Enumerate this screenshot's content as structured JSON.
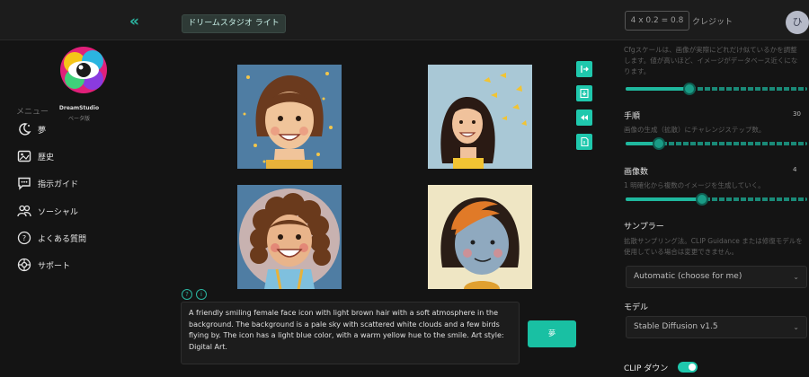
{
  "topbar": {
    "studio_button": "ドリームスタジオ ライト",
    "credit_formula": "4 x 0.2 = 0.8",
    "credit_label": "クレジット",
    "avatar_initial": "ひ"
  },
  "sidebar": {
    "app_name": "DreamStudio",
    "app_subtitle": "ベータ版",
    "menu_label": "メニュー",
    "items": [
      {
        "label": "夢",
        "icon": "dream-icon"
      },
      {
        "label": "歴史",
        "icon": "history-icon"
      },
      {
        "label": "指示ガイド",
        "icon": "prompt-guide-icon"
      },
      {
        "label": "ソーシャル",
        "icon": "social-icon"
      },
      {
        "label": "よくある質問",
        "icon": "faq-icon"
      },
      {
        "label": "サポート",
        "icon": "support-icon"
      }
    ]
  },
  "main": {
    "prompt_text": "A friendly smiling female face icon with light brown hair with a soft atmosphere in the background. The background is a pale sky with scattered white clouds and a few birds flying by. The icon has a light blue color, with a warm yellow hue to the smile. Art style: Digital Art.",
    "dream_button": "夢",
    "tools": [
      "expand-icon",
      "download-icon",
      "rewind-icon",
      "document-icon"
    ]
  },
  "right": {
    "cfg_description": "Cfgスケールは、画像が実際にどれだけ似ているかを調整します。値が高いほど、イメージがデータベース近くになります。",
    "cfg_value": 0.35,
    "steps_heading": "手順",
    "steps_value": "30",
    "steps_description": "画像の生成（拡散）にチャレンジステップ数。",
    "images_heading": "画像数",
    "images_value": "4",
    "images_description": "1 明確化から複数のイメージを生成していく。",
    "sampler_heading": "サンプラー",
    "sampler_description": "拡散サンプリング法。CLIP Guidance または修復モデルを使用している場合は変更できません。",
    "sampler_value": "Automatic (choose for me)",
    "model_heading": "モデル",
    "model_value": "Stable Diffusion v1.5",
    "clip_label": "CLIP ダウン"
  },
  "colors": {
    "accent": "#1fc8ad",
    "background": "#141414"
  }
}
